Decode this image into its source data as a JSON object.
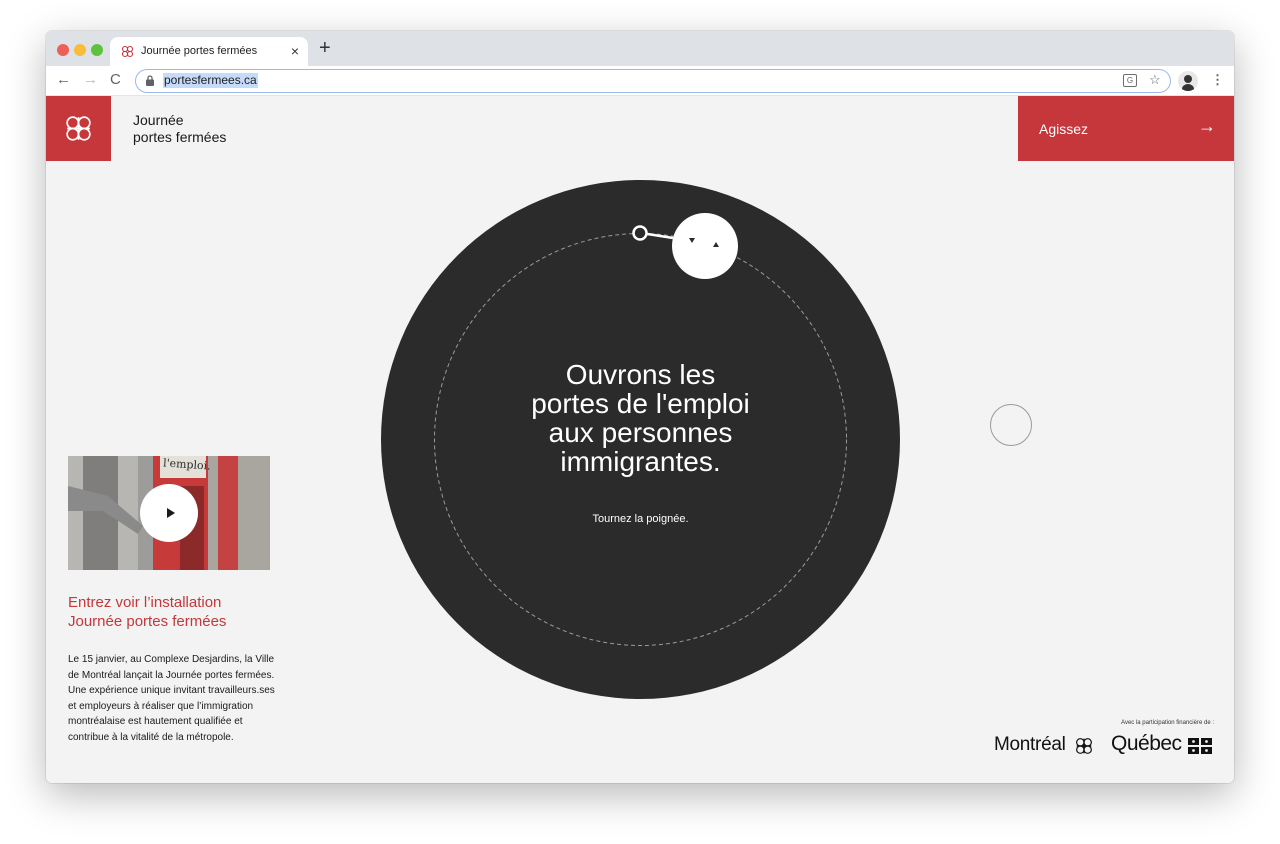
{
  "browser": {
    "tab_title": "Journée portes fermées",
    "tab_close": "×",
    "new_tab": "+",
    "url": "portesfermees.ca",
    "nav_back": "←",
    "nav_forward": "→",
    "nav_reload": "C",
    "star": "☆",
    "menu": "⋮",
    "translate": "G"
  },
  "header": {
    "site_title_line1": "Journée",
    "site_title_line2": "portes fermées",
    "cta_label": "Agissez",
    "cta_arrow": "→"
  },
  "dial": {
    "headline_line1": "Ouvrons les",
    "headline_line2": "portes de l'emploi",
    "headline_line3": "aux personnes",
    "headline_line4": "immigrantes.",
    "hint": "Tournez la poignée."
  },
  "video": {
    "sign_text": "l'emploi.",
    "title_line1": "Entrez voir l’installation",
    "title_line2": "Journée portes fermées",
    "description": "Le 15 janvier, au Complexe Desjardins, la Ville de Montréal lançait la Journée portes fermées. Une expérience unique invitant travailleurs.ses et employeurs à réaliser que l’immigration montréalaise est hautement qualifiée et contribue à la vitalité de la métropole."
  },
  "footer": {
    "caption": "Avec la participation financière de :",
    "montreal": "Montréal",
    "quebec": "Québec"
  },
  "colors": {
    "brand_red": "#c5373a",
    "dial": "#2b2b2b",
    "background": "#f3f3f3"
  },
  "icons": [
    "montreal-flower-icon",
    "lock-icon",
    "translate-icon",
    "star-icon",
    "menu-icon",
    "play-icon",
    "arrow-right-icon",
    "quebec-flag-icon"
  ]
}
